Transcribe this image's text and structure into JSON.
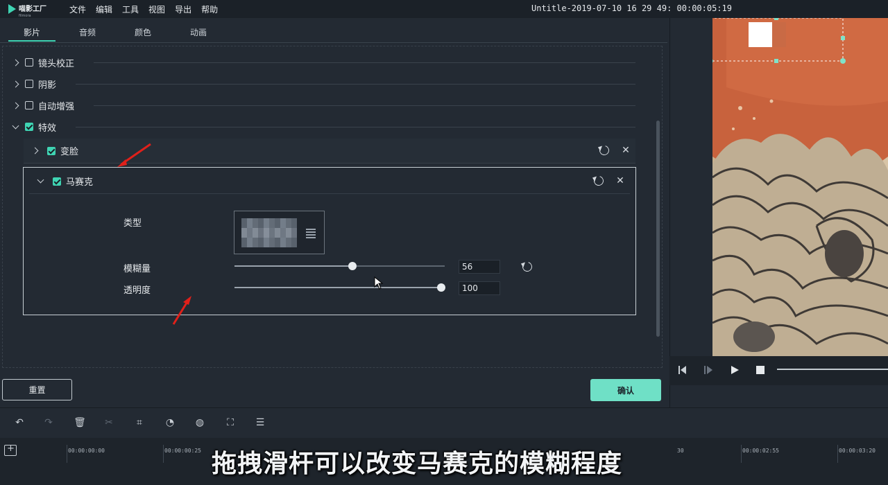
{
  "app": {
    "logo_text": "喵影工厂",
    "logo_sub": "filmora",
    "window_title": "Untitle-2019-07-10 16 29 49: 00:00:05:19"
  },
  "menu": [
    "文件",
    "编辑",
    "工具",
    "视图",
    "导出",
    "帮助"
  ],
  "tabs": [
    "影片",
    "音频",
    "颜色",
    "动画"
  ],
  "sections": [
    {
      "label": "镜头校正",
      "checked": false,
      "expanded": false
    },
    {
      "label": "阴影",
      "checked": false,
      "expanded": false
    },
    {
      "label": "自动增强",
      "checked": false,
      "expanded": false
    },
    {
      "label": "特效",
      "checked": true,
      "expanded": true
    }
  ],
  "effects": [
    {
      "label": "变脸",
      "checked": true,
      "expanded": false
    },
    {
      "label": "马赛克",
      "checked": true,
      "expanded": true
    }
  ],
  "mosaic": {
    "type_label": "类型",
    "blur_label": "模糊量",
    "blur_value": "56",
    "blur_fraction": 0.56,
    "opacity_label": "透明度",
    "opacity_value": "100",
    "opacity_fraction": 1.0
  },
  "buttons": {
    "reset": "重置",
    "confirm": "确认"
  },
  "timeline": {
    "ticks": [
      "00:00:00:00",
      "00:00:00:25",
      "",
      "",
      "",
      "",
      "",
      "00:00:02:55",
      "00:00:03:20"
    ],
    "tick_partial": "30"
  },
  "subtitle": "拖拽滑杆可以改变马赛克的模糊程度",
  "colors": {
    "accent": "#3fd4b3",
    "confirm_bg": "#6fe0c6",
    "panel_bg": "#232a33",
    "annotation_arrow": "#e0201a"
  }
}
